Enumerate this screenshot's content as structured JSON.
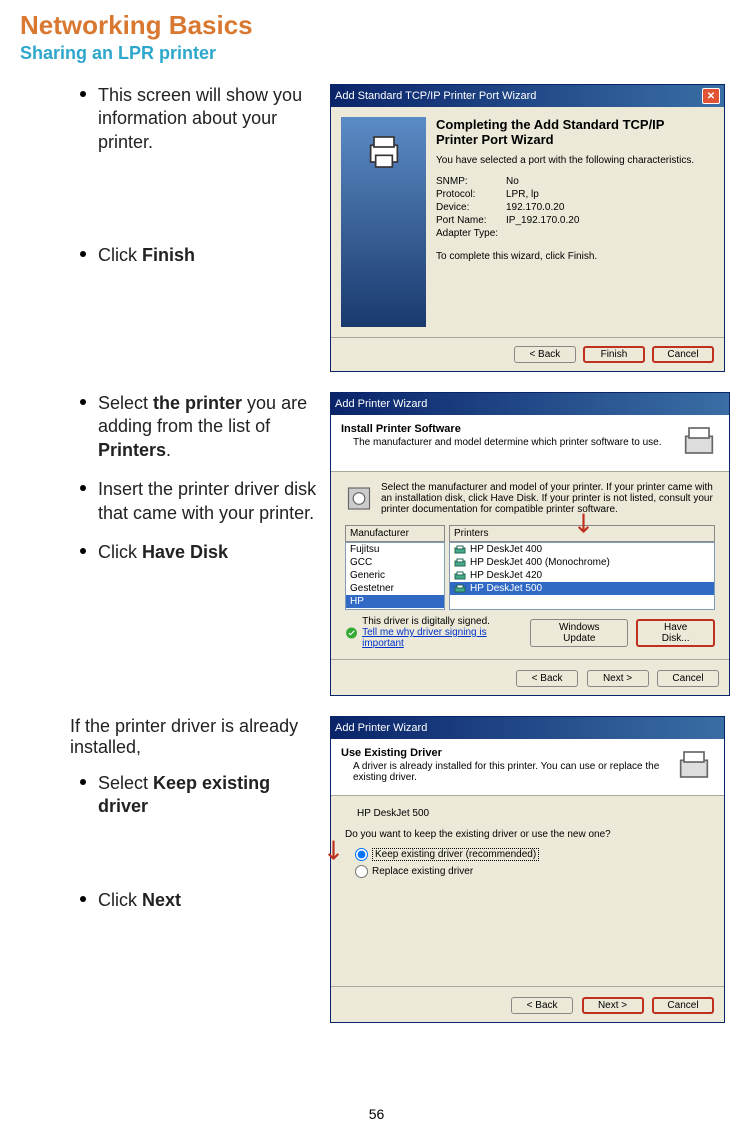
{
  "heading": "Networking Basics",
  "subheading": "Sharing an LPR printer",
  "pageNum": "56",
  "section1": {
    "bullet1": "This screen will show you information about your printer.",
    "bullet2_pre": "Click ",
    "bullet2_b": "Finish"
  },
  "dialog1": {
    "title": "Add Standard TCP/IP Printer Port Wizard",
    "wizTitle": "Completing the Add Standard TCP/IP Printer Port Wizard",
    "desc": "You have selected a port with the following characteristics.",
    "rows": [
      {
        "lbl": "SNMP:",
        "val": "No"
      },
      {
        "lbl": "Protocol:",
        "val": "LPR, lp"
      },
      {
        "lbl": "Device:",
        "val": "192.170.0.20"
      },
      {
        "lbl": "Port Name:",
        "val": "IP_192.170.0.20"
      },
      {
        "lbl": "Adapter Type:",
        "val": ""
      }
    ],
    "finishLine": "To complete this wizard, click Finish.",
    "back": "< Back",
    "finish": "Finish",
    "cancel": "Cancel"
  },
  "section2": {
    "b1_pre": "Select ",
    "b1_b1": "the printer",
    "b1_mid": " you are adding from the list of ",
    "b1_b2": "Printers",
    "b1_post": ".",
    "b2": "Insert the printer driver disk that came with your printer.",
    "b3_pre": "Click ",
    "b3_b": "Have Disk"
  },
  "dialog2": {
    "title": "Add Printer Wizard",
    "htitle": "Install Printer Software",
    "hdesc": "The manufacturer and model determine which printer software to use.",
    "inst": "Select the manufacturer and model of your printer. If your printer came with an installation disk, click Have Disk. If your printer is not listed, consult your printer documentation for compatible printer software.",
    "mfrHeader": "Manufacturer",
    "prnHeader": "Printers",
    "mfrs": [
      "Fujitsu",
      "GCC",
      "Generic",
      "Gestetner",
      "HP"
    ],
    "printers": [
      "HP DeskJet 400",
      "HP DeskJet 400 (Monochrome)",
      "HP DeskJet 420",
      "HP DeskJet 500"
    ],
    "selectedPrinter": 3,
    "signText": "This driver is digitally signed.",
    "signLink": "Tell me why driver signing is important",
    "winUpdate": "Windows Update",
    "haveDisk": "Have Disk...",
    "back": "< Back",
    "next": "Next >",
    "cancel": "Cancel"
  },
  "section3": {
    "intro": "If the printer driver is already installed,",
    "b1_pre": "Select ",
    "b1_b": "Keep existing driver",
    "b2_pre": "Click ",
    "b2_b": "Next"
  },
  "dialog3": {
    "title": "Add Printer Wizard",
    "htitle": "Use Existing Driver",
    "hdesc": "A driver is already installed for this printer. You can use or replace the existing driver.",
    "printer": "HP DeskJet 500",
    "question": "Do you want to keep the existing driver or use the new one?",
    "r1": "Keep existing driver (recommended)",
    "r2": "Replace existing driver",
    "back": "< Back",
    "next": "Next >",
    "cancel": "Cancel"
  }
}
